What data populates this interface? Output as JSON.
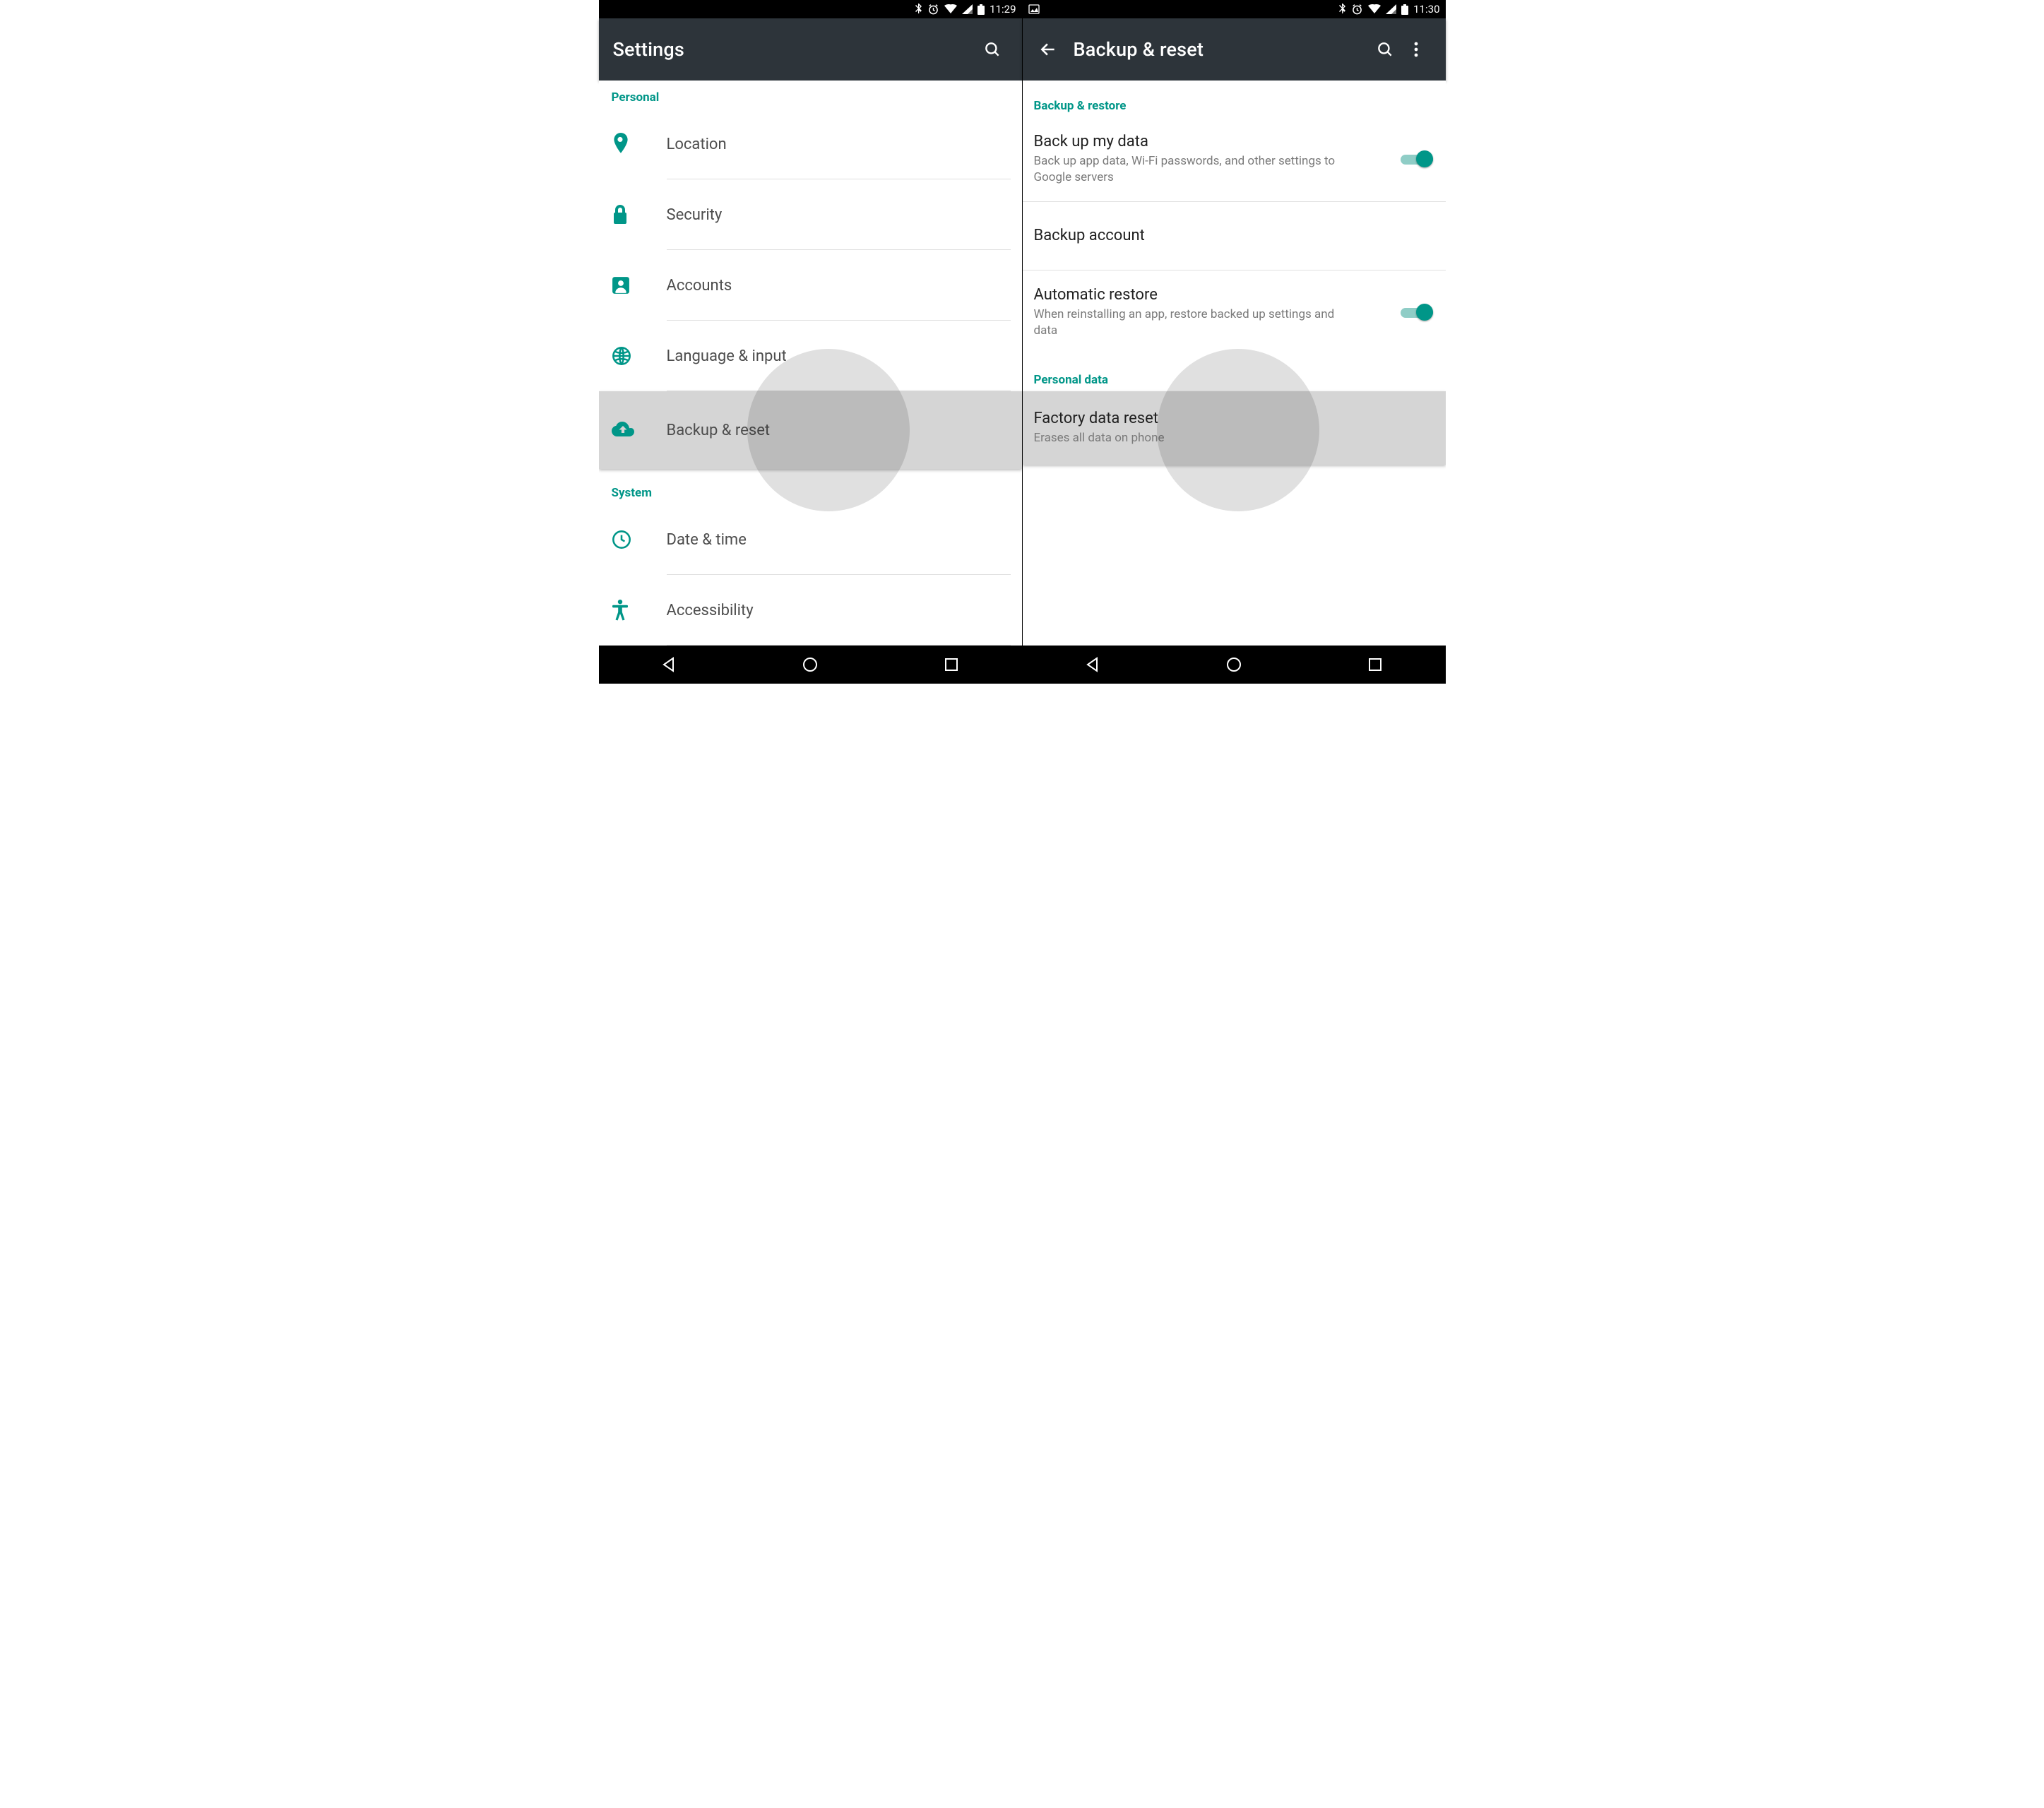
{
  "colors": {
    "accent": "#009688",
    "appbar": "#2d343a"
  },
  "left": {
    "status": {
      "time": "11:29"
    },
    "appbar": {
      "title": "Settings"
    },
    "sections": [
      {
        "label": "Personal",
        "items": [
          {
            "icon": "location-icon",
            "title": "Location"
          },
          {
            "icon": "lock-icon",
            "title": "Security"
          },
          {
            "icon": "accounts-icon",
            "title": "Accounts"
          },
          {
            "icon": "globe-icon",
            "title": "Language & input"
          },
          {
            "icon": "backup-icon",
            "title": "Backup & reset",
            "pressed": true
          }
        ]
      },
      {
        "label": "System",
        "items": [
          {
            "icon": "clock-icon",
            "title": "Date & time"
          },
          {
            "icon": "accessibility-icon",
            "title": "Accessibility"
          }
        ]
      }
    ]
  },
  "right": {
    "status": {
      "time": "11:30"
    },
    "appbar": {
      "title": "Backup & reset"
    },
    "sections": [
      {
        "label": "Backup & restore",
        "items": [
          {
            "title": "Back up my data",
            "sub": "Back up app data, Wi-Fi passwords, and other settings to Google servers",
            "switch": true,
            "switch_on": true
          },
          {
            "title": "Backup account"
          },
          {
            "title": "Automatic restore",
            "sub": "When reinstalling an app, restore backed up settings and data",
            "switch": true,
            "switch_on": true
          }
        ]
      },
      {
        "label": "Personal data",
        "items": [
          {
            "title": "Factory data reset",
            "sub": "Erases all data on phone",
            "pressed": true
          }
        ]
      }
    ]
  }
}
